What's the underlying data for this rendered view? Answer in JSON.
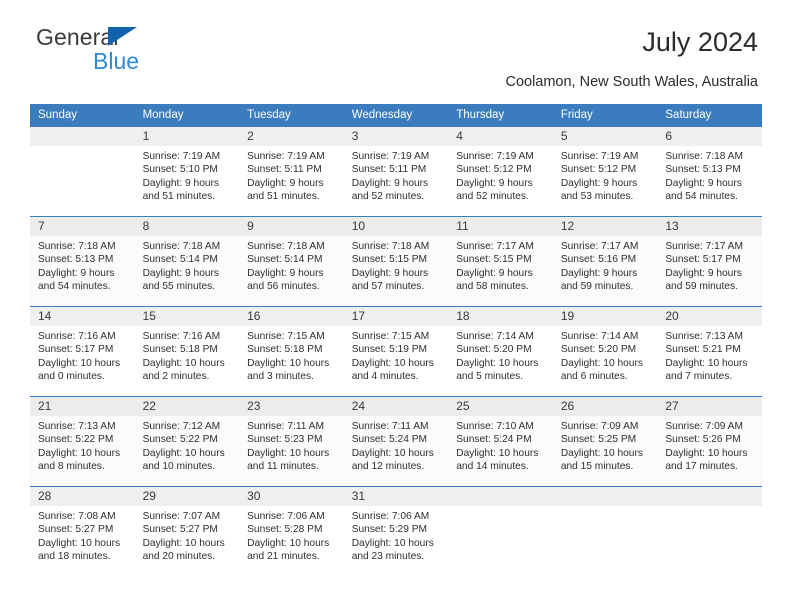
{
  "brand": {
    "line1": "General",
    "line2": "Blue",
    "triangle_color": "#1263ac",
    "line2_color": "#2e8ad6"
  },
  "header": {
    "title": "July 2024",
    "location": "Coolamon, New South Wales, Australia",
    "header_bg": "#3a7cbe",
    "header_text_color": "#ffffff"
  },
  "weekday_headers": [
    "Sunday",
    "Monday",
    "Tuesday",
    "Wednesday",
    "Thursday",
    "Friday",
    "Saturday"
  ],
  "labels": {
    "sunrise_prefix": "Sunrise:",
    "sunset_prefix": "Sunset:",
    "daylight_prefix": "Daylight:"
  },
  "weeks": [
    [
      {
        "day": "",
        "empty": true
      },
      {
        "day": "1",
        "sunrise": "Sunrise: 7:19 AM",
        "sunset": "Sunset: 5:10 PM",
        "daylight_line1": "Daylight: 9 hours",
        "daylight_line2": "and 51 minutes."
      },
      {
        "day": "2",
        "sunrise": "Sunrise: 7:19 AM",
        "sunset": "Sunset: 5:11 PM",
        "daylight_line1": "Daylight: 9 hours",
        "daylight_line2": "and 51 minutes."
      },
      {
        "day": "3",
        "sunrise": "Sunrise: 7:19 AM",
        "sunset": "Sunset: 5:11 PM",
        "daylight_line1": "Daylight: 9 hours",
        "daylight_line2": "and 52 minutes."
      },
      {
        "day": "4",
        "sunrise": "Sunrise: 7:19 AM",
        "sunset": "Sunset: 5:12 PM",
        "daylight_line1": "Daylight: 9 hours",
        "daylight_line2": "and 52 minutes."
      },
      {
        "day": "5",
        "sunrise": "Sunrise: 7:19 AM",
        "sunset": "Sunset: 5:12 PM",
        "daylight_line1": "Daylight: 9 hours",
        "daylight_line2": "and 53 minutes."
      },
      {
        "day": "6",
        "sunrise": "Sunrise: 7:18 AM",
        "sunset": "Sunset: 5:13 PM",
        "daylight_line1": "Daylight: 9 hours",
        "daylight_line2": "and 54 minutes."
      }
    ],
    [
      {
        "day": "7",
        "sunrise": "Sunrise: 7:18 AM",
        "sunset": "Sunset: 5:13 PM",
        "daylight_line1": "Daylight: 9 hours",
        "daylight_line2": "and 54 minutes."
      },
      {
        "day": "8",
        "sunrise": "Sunrise: 7:18 AM",
        "sunset": "Sunset: 5:14 PM",
        "daylight_line1": "Daylight: 9 hours",
        "daylight_line2": "and 55 minutes."
      },
      {
        "day": "9",
        "sunrise": "Sunrise: 7:18 AM",
        "sunset": "Sunset: 5:14 PM",
        "daylight_line1": "Daylight: 9 hours",
        "daylight_line2": "and 56 minutes."
      },
      {
        "day": "10",
        "sunrise": "Sunrise: 7:18 AM",
        "sunset": "Sunset: 5:15 PM",
        "daylight_line1": "Daylight: 9 hours",
        "daylight_line2": "and 57 minutes."
      },
      {
        "day": "11",
        "sunrise": "Sunrise: 7:17 AM",
        "sunset": "Sunset: 5:15 PM",
        "daylight_line1": "Daylight: 9 hours",
        "daylight_line2": "and 58 minutes."
      },
      {
        "day": "12",
        "sunrise": "Sunrise: 7:17 AM",
        "sunset": "Sunset: 5:16 PM",
        "daylight_line1": "Daylight: 9 hours",
        "daylight_line2": "and 59 minutes."
      },
      {
        "day": "13",
        "sunrise": "Sunrise: 7:17 AM",
        "sunset": "Sunset: 5:17 PM",
        "daylight_line1": "Daylight: 9 hours",
        "daylight_line2": "and 59 minutes."
      }
    ],
    [
      {
        "day": "14",
        "sunrise": "Sunrise: 7:16 AM",
        "sunset": "Sunset: 5:17 PM",
        "daylight_line1": "Daylight: 10 hours",
        "daylight_line2": "and 0 minutes."
      },
      {
        "day": "15",
        "sunrise": "Sunrise: 7:16 AM",
        "sunset": "Sunset: 5:18 PM",
        "daylight_line1": "Daylight: 10 hours",
        "daylight_line2": "and 2 minutes."
      },
      {
        "day": "16",
        "sunrise": "Sunrise: 7:15 AM",
        "sunset": "Sunset: 5:18 PM",
        "daylight_line1": "Daylight: 10 hours",
        "daylight_line2": "and 3 minutes."
      },
      {
        "day": "17",
        "sunrise": "Sunrise: 7:15 AM",
        "sunset": "Sunset: 5:19 PM",
        "daylight_line1": "Daylight: 10 hours",
        "daylight_line2": "and 4 minutes."
      },
      {
        "day": "18",
        "sunrise": "Sunrise: 7:14 AM",
        "sunset": "Sunset: 5:20 PM",
        "daylight_line1": "Daylight: 10 hours",
        "daylight_line2": "and 5 minutes."
      },
      {
        "day": "19",
        "sunrise": "Sunrise: 7:14 AM",
        "sunset": "Sunset: 5:20 PM",
        "daylight_line1": "Daylight: 10 hours",
        "daylight_line2": "and 6 minutes."
      },
      {
        "day": "20",
        "sunrise": "Sunrise: 7:13 AM",
        "sunset": "Sunset: 5:21 PM",
        "daylight_line1": "Daylight: 10 hours",
        "daylight_line2": "and 7 minutes."
      }
    ],
    [
      {
        "day": "21",
        "sunrise": "Sunrise: 7:13 AM",
        "sunset": "Sunset: 5:22 PM",
        "daylight_line1": "Daylight: 10 hours",
        "daylight_line2": "and 8 minutes."
      },
      {
        "day": "22",
        "sunrise": "Sunrise: 7:12 AM",
        "sunset": "Sunset: 5:22 PM",
        "daylight_line1": "Daylight: 10 hours",
        "daylight_line2": "and 10 minutes."
      },
      {
        "day": "23",
        "sunrise": "Sunrise: 7:11 AM",
        "sunset": "Sunset: 5:23 PM",
        "daylight_line1": "Daylight: 10 hours",
        "daylight_line2": "and 11 minutes."
      },
      {
        "day": "24",
        "sunrise": "Sunrise: 7:11 AM",
        "sunset": "Sunset: 5:24 PM",
        "daylight_line1": "Daylight: 10 hours",
        "daylight_line2": "and 12 minutes."
      },
      {
        "day": "25",
        "sunrise": "Sunrise: 7:10 AM",
        "sunset": "Sunset: 5:24 PM",
        "daylight_line1": "Daylight: 10 hours",
        "daylight_line2": "and 14 minutes."
      },
      {
        "day": "26",
        "sunrise": "Sunrise: 7:09 AM",
        "sunset": "Sunset: 5:25 PM",
        "daylight_line1": "Daylight: 10 hours",
        "daylight_line2": "and 15 minutes."
      },
      {
        "day": "27",
        "sunrise": "Sunrise: 7:09 AM",
        "sunset": "Sunset: 5:26 PM",
        "daylight_line1": "Daylight: 10 hours",
        "daylight_line2": "and 17 minutes."
      }
    ],
    [
      {
        "day": "28",
        "sunrise": "Sunrise: 7:08 AM",
        "sunset": "Sunset: 5:27 PM",
        "daylight_line1": "Daylight: 10 hours",
        "daylight_line2": "and 18 minutes."
      },
      {
        "day": "29",
        "sunrise": "Sunrise: 7:07 AM",
        "sunset": "Sunset: 5:27 PM",
        "daylight_line1": "Daylight: 10 hours",
        "daylight_line2": "and 20 minutes."
      },
      {
        "day": "30",
        "sunrise": "Sunrise: 7:06 AM",
        "sunset": "Sunset: 5:28 PM",
        "daylight_line1": "Daylight: 10 hours",
        "daylight_line2": "and 21 minutes."
      },
      {
        "day": "31",
        "sunrise": "Sunrise: 7:06 AM",
        "sunset": "Sunset: 5:29 PM",
        "daylight_line1": "Daylight: 10 hours",
        "daylight_line2": "and 23 minutes."
      },
      {
        "day": "",
        "empty": true
      },
      {
        "day": "",
        "empty": true
      },
      {
        "day": "",
        "empty": true
      }
    ]
  ]
}
